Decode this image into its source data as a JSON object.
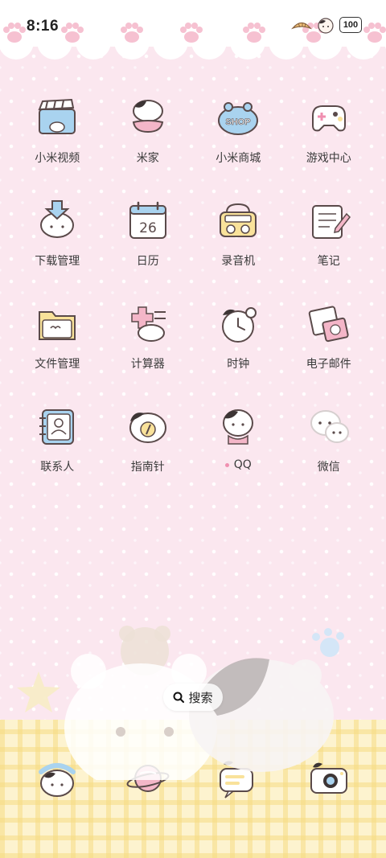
{
  "status_bar": {
    "time": "8:16",
    "battery": "100"
  },
  "apps": [
    {
      "label": "小米视频",
      "icon": "video-clapper-icon"
    },
    {
      "label": "米家",
      "icon": "home-cat-icon"
    },
    {
      "label": "小米商城",
      "icon": "shop-bag-icon"
    },
    {
      "label": "游戏中心",
      "icon": "gamepad-icon"
    },
    {
      "label": "下载管理",
      "icon": "download-icon"
    },
    {
      "label": "日历",
      "icon": "calendar-icon",
      "day": "26"
    },
    {
      "label": "录音机",
      "icon": "radio-recorder-icon"
    },
    {
      "label": "笔记",
      "icon": "notepad-icon"
    },
    {
      "label": "文件管理",
      "icon": "folder-icon"
    },
    {
      "label": "计算器",
      "icon": "calculator-icon"
    },
    {
      "label": "时钟",
      "icon": "alarm-clock-icon"
    },
    {
      "label": "电子邮件",
      "icon": "mail-icon"
    },
    {
      "label": "联系人",
      "icon": "contacts-book-icon"
    },
    {
      "label": "指南针",
      "icon": "compass-icon"
    },
    {
      "label": "QQ",
      "icon": "qq-penguin-icon",
      "badge_dot": true
    },
    {
      "label": "微信",
      "icon": "wechat-bubble-icon"
    }
  ],
  "search": {
    "label": "搜索"
  },
  "dock": [
    {
      "icon": "phone-bear-icon"
    },
    {
      "icon": "planet-browser-icon"
    },
    {
      "icon": "messages-icon"
    },
    {
      "icon": "camera-icon"
    }
  ],
  "colors": {
    "background": "#fbe7ef",
    "plaid": "#fdf3cf",
    "label_text": "#3b3b3b",
    "icon_outline": "#5a4a4a",
    "accent_blue": "#a9d3ef",
    "accent_pink": "#f4b6c8",
    "accent_yellow": "#f9e29a"
  }
}
